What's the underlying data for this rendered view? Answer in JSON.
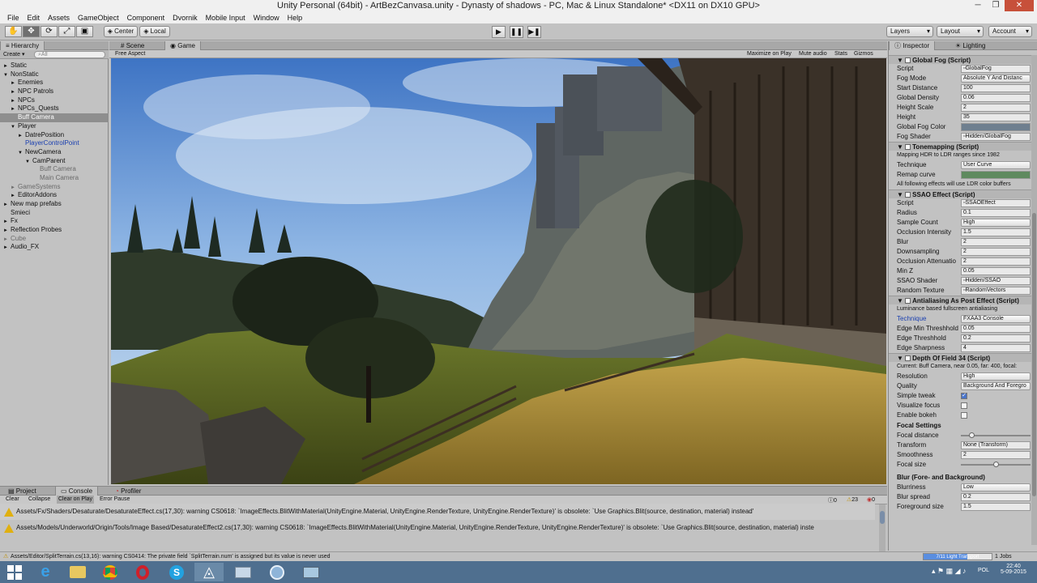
{
  "window": {
    "title": "Unity Personal (64bit) - ArtBezCanvasa.unity - Dynasty of shadows - PC, Mac & Linux Standalone* <DX11 on DX10 GPU>"
  },
  "menu": [
    "File",
    "Edit",
    "Assets",
    "GameObject",
    "Component",
    "Dvornik",
    "Mobile Input",
    "Window",
    "Help"
  ],
  "toolbar": {
    "center": "Center",
    "local": "Local",
    "layers": "Layers",
    "layout": "Layout",
    "account": "Account"
  },
  "hierarchy": {
    "tab": "Hierarchy",
    "create": "Create",
    "search_placeholder": "All",
    "items": [
      {
        "label": "Static",
        "indent": 0,
        "arrow": "►",
        "style": ""
      },
      {
        "label": "NonStatic",
        "indent": 0,
        "arrow": "▼",
        "style": ""
      },
      {
        "label": "Enemies",
        "indent": 1,
        "arrow": "►",
        "style": ""
      },
      {
        "label": "NPC Patrols",
        "indent": 1,
        "arrow": "►",
        "style": ""
      },
      {
        "label": "NPCs",
        "indent": 1,
        "arrow": "►",
        "style": ""
      },
      {
        "label": "NPCs_Quests",
        "indent": 1,
        "arrow": "►",
        "style": ""
      },
      {
        "label": "Buff Camera",
        "indent": 1,
        "arrow": "",
        "style": "sel"
      },
      {
        "label": "Player",
        "indent": 1,
        "arrow": "▼",
        "style": ""
      },
      {
        "label": "DatrePosition",
        "indent": 2,
        "arrow": "►",
        "style": ""
      },
      {
        "label": "PlayerControlPoint",
        "indent": 2,
        "arrow": "",
        "style": "blue"
      },
      {
        "label": "NewCamera",
        "indent": 2,
        "arrow": "▼",
        "style": ""
      },
      {
        "label": "CamParent",
        "indent": 3,
        "arrow": "▼",
        "style": ""
      },
      {
        "label": "Buff Camera",
        "indent": 4,
        "arrow": "",
        "style": "gray"
      },
      {
        "label": "Main Camera",
        "indent": 4,
        "arrow": "",
        "style": "gray"
      },
      {
        "label": "GameSystems",
        "indent": 1,
        "arrow": "►",
        "style": "gray"
      },
      {
        "label": "EditorAddons",
        "indent": 1,
        "arrow": "►",
        "style": ""
      },
      {
        "label": "New map prefabs",
        "indent": 0,
        "arrow": "►",
        "style": ""
      },
      {
        "label": "Smieci",
        "indent": 0,
        "arrow": "",
        "style": ""
      },
      {
        "label": "Fx",
        "indent": 0,
        "arrow": "►",
        "style": ""
      },
      {
        "label": "Reflection Probes",
        "indent": 0,
        "arrow": "►",
        "style": ""
      },
      {
        "label": "Cube",
        "indent": 0,
        "arrow": "►",
        "style": "gray"
      },
      {
        "label": "Audio_FX",
        "indent": 0,
        "arrow": "►",
        "style": ""
      }
    ]
  },
  "gameview": {
    "tabs": [
      "Scene",
      "Game"
    ],
    "aspect": "Free Aspect",
    "buttons": [
      "Maximize on Play",
      "Mute audio",
      "Stats",
      "Gizmos"
    ]
  },
  "inspector": {
    "tabs": [
      "Inspector",
      "Lighting"
    ],
    "globalfog": {
      "title": "Global Fog (Script)",
      "props": [
        {
          "label": "Script",
          "value": "GlobalFog",
          "kind": "obj"
        },
        {
          "label": "Fog Mode",
          "value": "Absolute Y And Distanc",
          "kind": "drop"
        },
        {
          "label": "Start Distance",
          "value": "100",
          "kind": "field"
        },
        {
          "label": "Global Density",
          "value": "0.06",
          "kind": "field"
        },
        {
          "label": "Height Scale",
          "value": "2",
          "kind": "field"
        },
        {
          "label": "Height",
          "value": "35",
          "kind": "field"
        },
        {
          "label": "Global Fog Color",
          "value": "",
          "kind": "color"
        },
        {
          "label": "Fog Shader",
          "value": "Hidden/GlobalFog",
          "kind": "obj"
        }
      ]
    },
    "tonemapping": {
      "title": "Tonemapping (Script)",
      "note1": "Mapping HDR to LDR ranges since 1982",
      "technique_label": "Technique",
      "technique": "User Curve",
      "remap_label": "Remap curve",
      "note2": "All following effects will use LDR color buffers"
    },
    "ssao": {
      "title": "SSAO Effect (Script)",
      "props": [
        {
          "label": "Script",
          "value": "SSAOEffect",
          "kind": "obj"
        },
        {
          "label": "Radius",
          "value": "0.1",
          "kind": "field"
        },
        {
          "label": "Sample Count",
          "value": "High",
          "kind": "drop"
        },
        {
          "label": "Occlusion Intensity",
          "value": "1.5",
          "kind": "field"
        },
        {
          "label": "Blur",
          "value": "2",
          "kind": "field"
        },
        {
          "label": "Downsampling",
          "value": "2",
          "kind": "field"
        },
        {
          "label": "Occlusion Attenuatio",
          "value": "2",
          "kind": "field"
        },
        {
          "label": "Min Z",
          "value": "0.05",
          "kind": "field"
        },
        {
          "label": "SSAO Shader",
          "value": "Hidden/SSAO",
          "kind": "obj"
        },
        {
          "label": "Random Texture",
          "value": "RandomVectors",
          "kind": "obj"
        }
      ]
    },
    "antialiasing": {
      "title": "Antialiasing As Post Effect (Script)",
      "note": "Luminance based fullscreen antialiasing",
      "props": [
        {
          "label": "Technique",
          "value": "FXAA3 Console",
          "kind": "drop"
        },
        {
          "label": "Edge Min Threshhold",
          "value": "0.05",
          "kind": "field"
        },
        {
          "label": "Edge Threshhold",
          "value": "0.2",
          "kind": "field"
        },
        {
          "label": "Edge Sharpness",
          "value": "4",
          "kind": "field"
        }
      ]
    },
    "dof": {
      "title": "Depth Of Field 34 (Script)",
      "note": "Current: Buff Camera, near 0.05, far: 400, focal:",
      "resolution_label": "Resolution",
      "resolution": "High",
      "quality_label": "Quality",
      "quality": "Background And Foregro",
      "checks": [
        {
          "label": "Simple tweak",
          "checked": true
        },
        {
          "label": "Visualize focus",
          "checked": false
        },
        {
          "label": "Enable bokeh",
          "checked": false
        }
      ],
      "focal_title": "Focal Settings",
      "focal_distance_label": "Focal distance",
      "focal_distance": 0.15,
      "transform_label": "Transform",
      "transform": "None (Transform)",
      "smoothness_label": "Smoothness",
      "smoothness": "2",
      "focal_size_label": "Focal size",
      "focal_size": 0.5,
      "blur_title": "Blur (Fore- and Background)",
      "blurriness_label": "Blurriness",
      "blurriness": "Low",
      "blur_spread_label": "Blur spread",
      "blur_spread": "0.2",
      "fg_size_label": "Foreground size",
      "fg_size": "1.5"
    }
  },
  "console": {
    "tabs": [
      "Project",
      "Console",
      "Profiler"
    ],
    "buttons": [
      "Clear",
      "Collapse",
      "Clear on Play",
      "Error Pause"
    ],
    "counts": {
      "errors": "0",
      "warnings": "23",
      "messages": "0"
    },
    "logs": [
      "Assets/Fx/Shaders/Desaturate/DesaturateEffect.cs(17,30): warning CS0618: `ImageEffects.BlitWithMaterial(UnityEngine.Material, UnityEngine.RenderTexture, UnityEngine.RenderTexture)' is obsolete: `Use Graphics.Blit(source, destination, material) instead'",
      "Assets/Models/Underworld/Origin/Tools/Image Based/DesaturateEffect2.cs(17,30): warning CS0618: `ImageEffects.BlitWithMaterial(UnityEngine.Material, UnityEngine.RenderTexture, UnityEngine.RenderTexture)' is obsolete: `Use Graphics.Blit(source, destination, material) inste"
    ]
  },
  "status": {
    "message": "Assets/Editor/SplitTerrain.cs(13,16): warning CS0414: The private field `SplitTerrain.num' is assigned but its value is never used",
    "progress_label": "7/11 Light Transport",
    "progress": 0.64,
    "jobs": "1 Jobs"
  },
  "taskbar": {
    "icons": [
      "windows-start-icon",
      "internet-explorer-icon",
      "file-explorer-icon",
      "chrome-icon",
      "opera-icon",
      "skype-icon",
      "unity-icon",
      "app-icon-1",
      "app-icon-2",
      "app-icon-3"
    ],
    "lang": "POL",
    "time": "22:40",
    "date": "5-09-2015"
  }
}
